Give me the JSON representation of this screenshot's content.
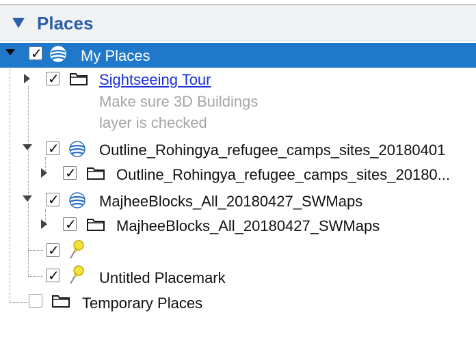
{
  "panel": {
    "title": "Places"
  },
  "tree": {
    "my_places": {
      "label": "My Places",
      "checked": true,
      "icon": "globe-icon"
    },
    "sightseeing": {
      "label": "Sightseeing Tour",
      "desc_line1": "Make sure 3D Buildings",
      "desc_line2": "layer is checked",
      "checked": true,
      "icon": "folder-icon"
    },
    "outline_kml": {
      "label": "Outline_Rohingya_refugee_camps_sites_20180401",
      "checked": true,
      "icon": "globe-icon"
    },
    "outline_folder": {
      "label": "Outline_Rohingya_refugee_camps_sites_20180...",
      "checked": true,
      "icon": "folder-icon"
    },
    "majhee_kml": {
      "label": "MajheeBlocks_All_20180427_SWMaps",
      "checked": true,
      "icon": "globe-icon"
    },
    "majhee_folder": {
      "label": "MajheeBlocks_All_20180427_SWMaps",
      "checked": true,
      "icon": "folder-icon"
    },
    "placemark_empty": {
      "label": "",
      "checked": true,
      "icon": "pushpin-icon"
    },
    "untitled_placemark": {
      "label": "Untitled Placemark",
      "checked": true,
      "icon": "pushpin-icon"
    },
    "temporary": {
      "label": "Temporary Places",
      "checked": false,
      "icon": "folder-icon"
    }
  },
  "colors": {
    "header_text": "#2b5fa8",
    "selection": "#1f78c9",
    "link": "#1a2fd6",
    "desc_text": "#a5a5a5"
  }
}
